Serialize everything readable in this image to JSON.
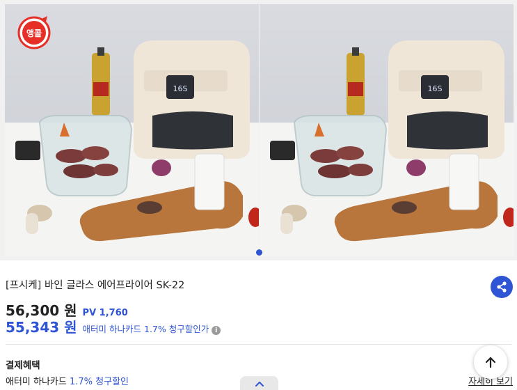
{
  "badge": {
    "label": "앵콜",
    "color": "#e63027"
  },
  "carousel": {
    "slides": 2,
    "active_index": 0
  },
  "airfryer_display": "16S",
  "product": {
    "title": "[프시케] 바인 글라스 에어프라이어 SK-22",
    "price": "56,300 원",
    "pv": "PV 1,760",
    "sale_price": "55,343 원",
    "sale_note": "애터미 하나카드 1.7% 청구할인가",
    "info_icon": "i"
  },
  "benefit": {
    "title": "결제혜택",
    "card": "애터미 하나카드",
    "discount": "1.7% 청구할인",
    "detail_link": "자세히 보기"
  },
  "colors": {
    "accent": "#2f55d4",
    "badge_red": "#e63027"
  }
}
